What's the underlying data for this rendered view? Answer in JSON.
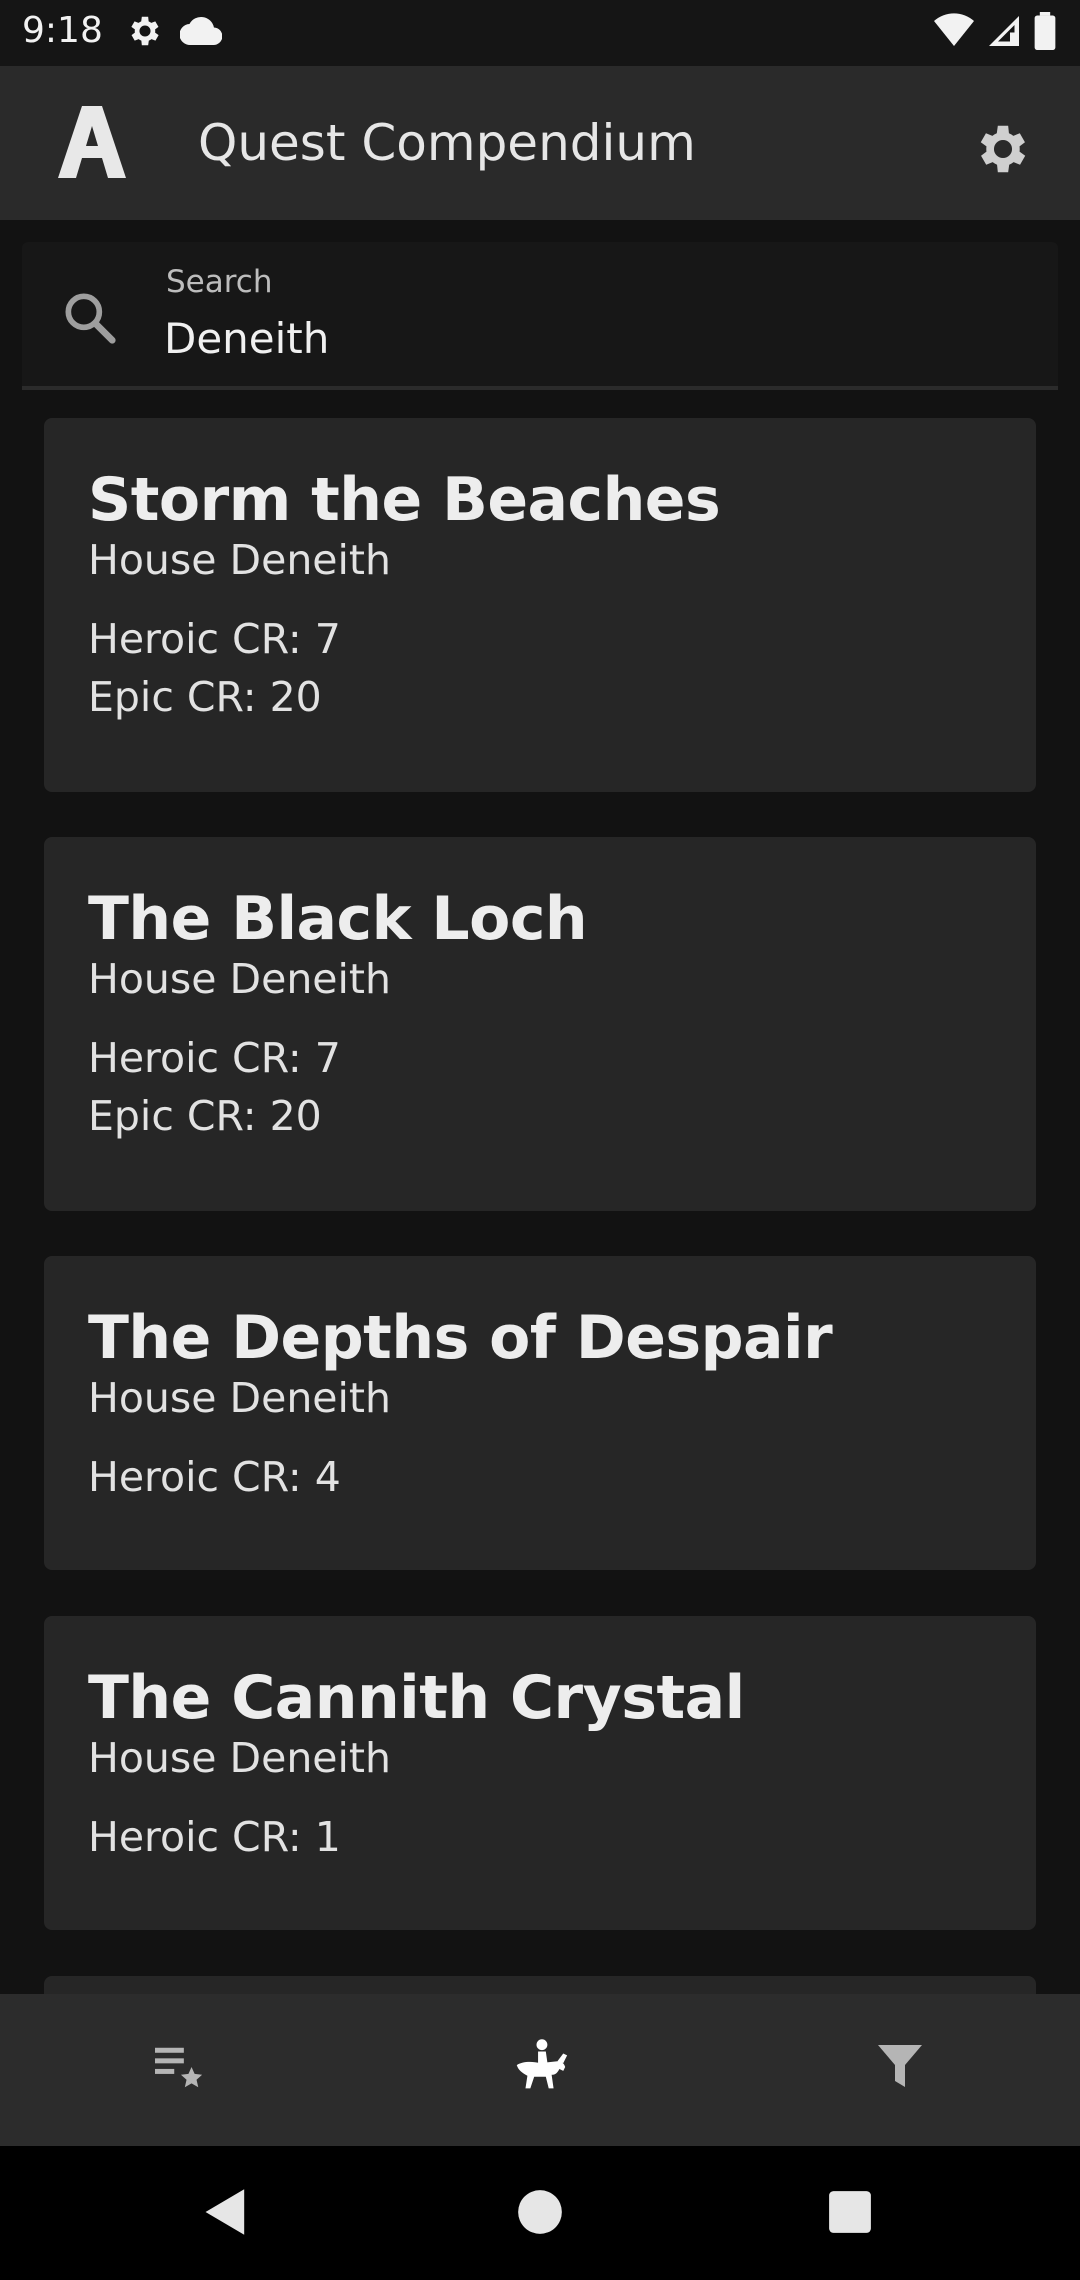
{
  "status_bar": {
    "time": "9:18",
    "left_icons": [
      "gear-icon",
      "cloud-icon"
    ],
    "right_icons": [
      "wifi-icon",
      "signal-icon",
      "battery-icon"
    ]
  },
  "app_bar": {
    "title": "Quest Compendium",
    "logo_icon": "app-logo-icon",
    "settings_icon": "gear-icon"
  },
  "search": {
    "label": "Search",
    "value": "Deneith"
  },
  "quests": [
    {
      "title": "Storm the Beaches",
      "house": "House Deneith",
      "heroic_cr": "Heroic CR: 7",
      "epic_cr": "Epic CR: 20"
    },
    {
      "title": "The Black Loch",
      "house": "House Deneith",
      "heroic_cr": "Heroic CR: 7",
      "epic_cr": "Epic CR: 20"
    },
    {
      "title": "The Depths of Despair",
      "house": "House Deneith",
      "heroic_cr": "Heroic CR: 4"
    },
    {
      "title": "The Cannith Crystal",
      "house": "House Deneith",
      "heroic_cr": "Heroic CR: 1"
    }
  ],
  "bottom_nav": {
    "items": [
      "favorites-list-icon",
      "quests-rider-icon",
      "filter-icon"
    ],
    "active": "quests-rider-icon"
  },
  "system_nav": {
    "items": [
      "back-icon",
      "home-icon",
      "recents-icon"
    ]
  },
  "colors": {
    "background": "#121212",
    "card": "#262626",
    "app_bar": "#2a2a2a",
    "bottom_nav": "#2c2c2c"
  }
}
